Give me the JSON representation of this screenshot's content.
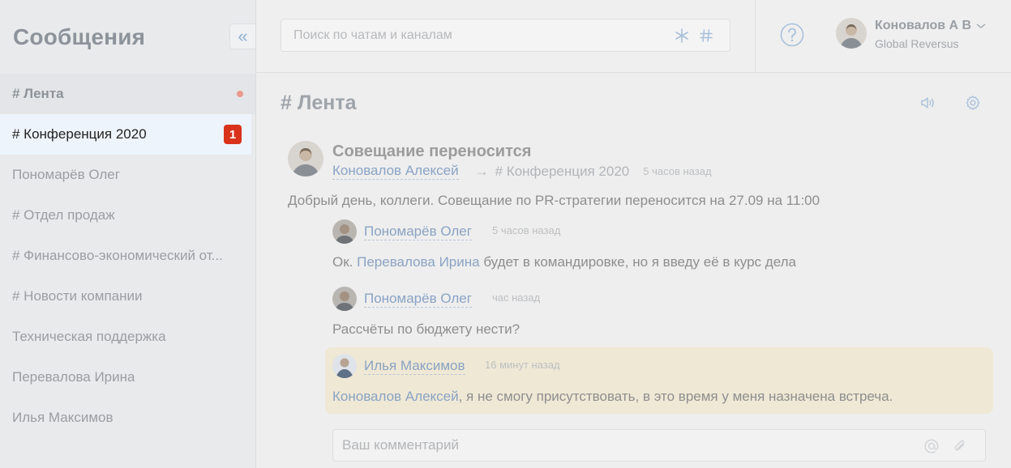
{
  "sidebar": {
    "title": "Сообщения",
    "collapse_glyph": "«",
    "items": [
      {
        "label": "# Лента",
        "indicator": "dot"
      },
      {
        "label": "# Конференция 2020",
        "badge": "1"
      },
      {
        "label": "Пономарёв Олег"
      },
      {
        "label": "# Отдел продаж"
      },
      {
        "label": "# Финансово-экономический от..."
      },
      {
        "label": "# Новости компании"
      },
      {
        "label": "Техническая поддержка"
      },
      {
        "label": "Перевалова Ирина"
      },
      {
        "label": "Илья Максимов"
      }
    ]
  },
  "header": {
    "search_placeholder": "Поиск по чатам и каналам",
    "user_name": "Коновалов А В",
    "user_org": "Global Reversus"
  },
  "channel": {
    "title": "# Лента"
  },
  "post": {
    "title": "Совещание переносится",
    "author": "Коновалов Алексей",
    "arrow": "→",
    "target": "# Конференция 2020",
    "time": "5 часов назад",
    "body": "Добрый день, коллеги. Совещание по PR-стратегии переносится на 27.09 на 11:00"
  },
  "comments": [
    {
      "author": "Пономарёв Олег",
      "time": "5 часов назад",
      "text_prefix": "Ок. ",
      "mention": "Перевалова Ирина",
      "text_suffix": " будет в командировке, но я введу её в курс дела"
    },
    {
      "author": "Пономарёв Олег",
      "time": "час назад",
      "text": "Рассчёты по бюджету нести?"
    },
    {
      "author": "Илья Максимов",
      "time": "16 минут назад",
      "mention": "Коновалов Алексей",
      "text_suffix": ", я не смогу присутствовать, в это время у меня назначена встреча."
    }
  ],
  "composer": {
    "placeholder": "Ваш комментарий"
  },
  "colors": {
    "accent_link": "#8aa3c4",
    "badge": "#d9331c",
    "unread_dot": "#ea9a8c",
    "highlight": "#efe8d5"
  },
  "icons": [
    "collapse-icon",
    "asterisk-icon",
    "hash-icon",
    "help-icon",
    "chevron-down-icon",
    "speaker-icon",
    "gear-icon",
    "at-icon",
    "paperclip-icon"
  ]
}
